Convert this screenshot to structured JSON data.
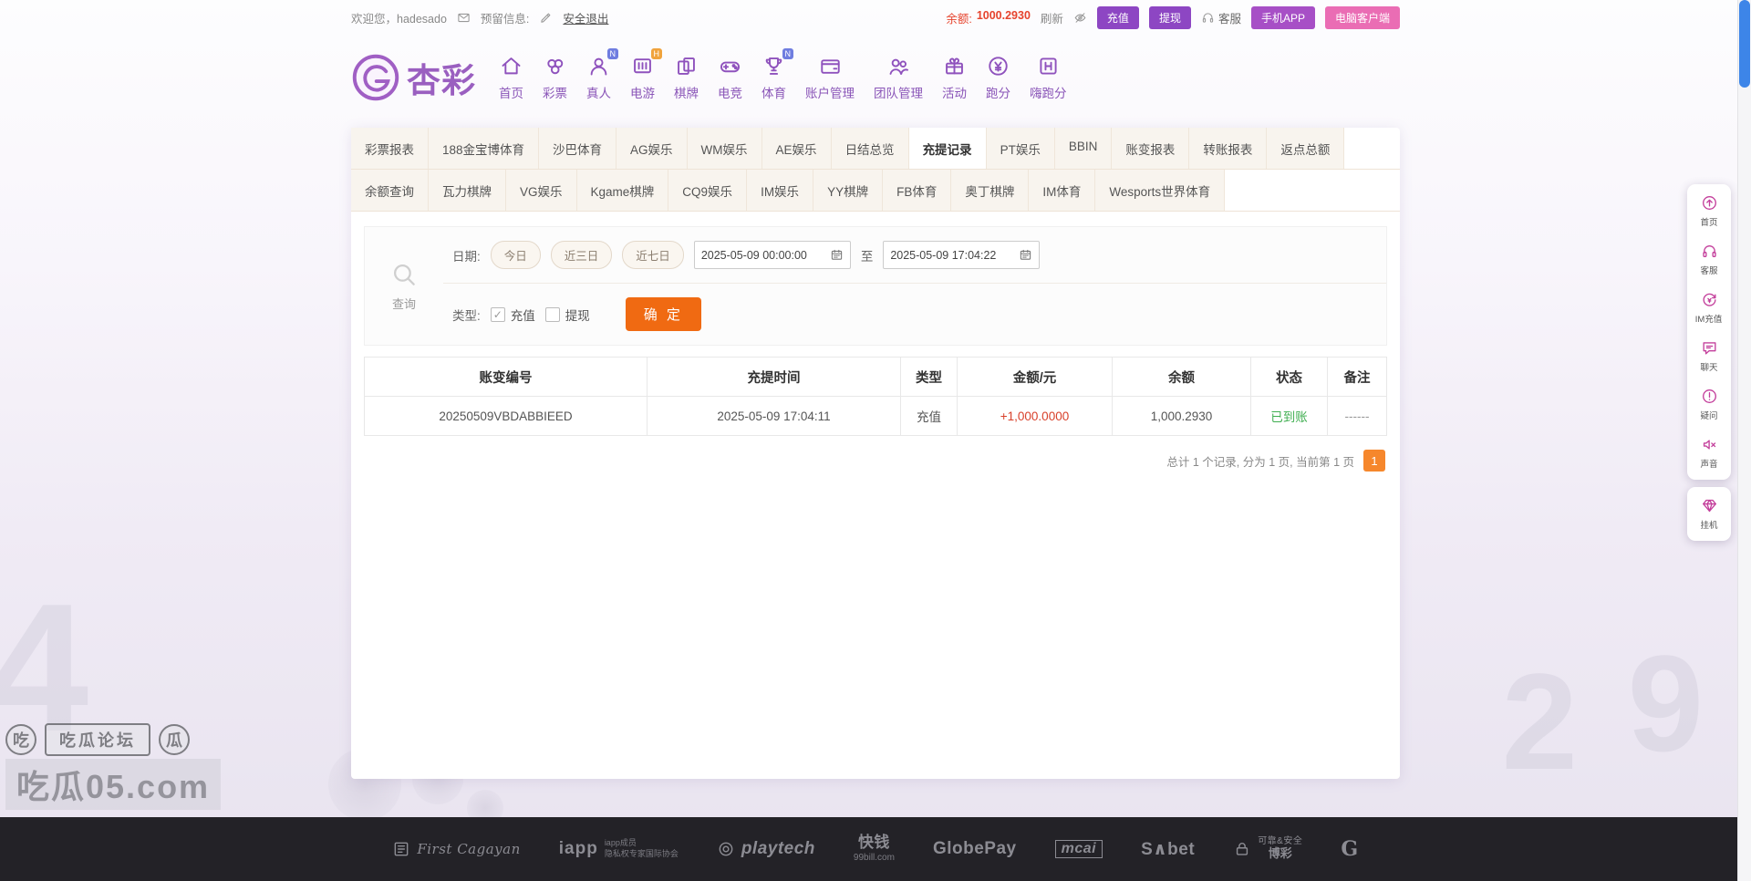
{
  "topbar": {
    "welcome": "欢迎您，hadesado",
    "reserved_label": "预留信息:",
    "logout": "安全退出",
    "balance_label": "余额:",
    "balance_value": "1000.2930",
    "refresh": "刷新",
    "deposit": "充值",
    "withdraw": "提现",
    "service": "客服",
    "mobile_app": "手机APP",
    "pc_client": "电脑客户端"
  },
  "brand": {
    "name": "杏彩"
  },
  "nav": {
    "items": [
      {
        "label": "首页",
        "icon": "home",
        "badge": ""
      },
      {
        "label": "彩票",
        "icon": "lottery",
        "badge": ""
      },
      {
        "label": "真人",
        "icon": "live",
        "badge": "N"
      },
      {
        "label": "电游",
        "icon": "egame",
        "badge": "H"
      },
      {
        "label": "棋牌",
        "icon": "chess",
        "badge": ""
      },
      {
        "label": "电竞",
        "icon": "esports",
        "badge": ""
      },
      {
        "label": "体育",
        "icon": "sports",
        "badge": "N"
      },
      {
        "label": "账户管理",
        "icon": "account",
        "badge": ""
      },
      {
        "label": "团队管理",
        "icon": "team",
        "badge": ""
      },
      {
        "label": "活动",
        "icon": "activity",
        "badge": ""
      },
      {
        "label": "跑分",
        "icon": "paofen",
        "badge": ""
      },
      {
        "label": "嗨跑分",
        "icon": "hipaofen",
        "badge": ""
      }
    ]
  },
  "tabs": {
    "active": "充提记录",
    "row1": [
      "彩票报表",
      "188金宝博体育",
      "沙巴体育",
      "AG娱乐",
      "WM娱乐",
      "AE娱乐",
      "日结总览",
      "充提记录",
      "PT娱乐",
      "BBIN",
      "账变报表",
      "转账报表",
      "返点总额"
    ],
    "row2": [
      "余额查询",
      "瓦力棋牌",
      "VG娱乐",
      "Kgame棋牌",
      "CQ9娱乐",
      "IM娱乐",
      "YY棋牌",
      "FB体育",
      "奥丁棋牌",
      "IM体育",
      "Wesports世界体育"
    ]
  },
  "filter": {
    "search_label": "查询",
    "date_label": "日期:",
    "quick_ranges": [
      "今日",
      "近三日",
      "近七日"
    ],
    "date_from": "2025-05-09 00:00:00",
    "to_label": "至",
    "date_to": "2025-05-09 17:04:22",
    "type_label": "类型:",
    "types": [
      {
        "label": "充值",
        "checked": true
      },
      {
        "label": "提现",
        "checked": false
      }
    ],
    "submit": "确 定"
  },
  "table": {
    "headers": [
      "账变编号",
      "充提时间",
      "类型",
      "金额/元",
      "余额",
      "状态",
      "备注"
    ],
    "rows": [
      {
        "cells": [
          "20250509VBDABBIEED",
          "2025-05-09 17:04:11",
          "充值",
          "+1,000.0000",
          "1,000.2930",
          "已到账",
          "------"
        ]
      }
    ]
  },
  "pagination": {
    "summary": "总计 1 个记录, 分为 1 页, 当前第 1 页",
    "current_page": "1"
  },
  "quickbar": {
    "items": [
      {
        "label": "首页",
        "icon": "top"
      },
      {
        "label": "客服",
        "icon": "headset"
      },
      {
        "label": "IM充值",
        "icon": "recharge"
      },
      {
        "label": "聊天",
        "icon": "chat"
      },
      {
        "label": "疑问",
        "icon": "question"
      },
      {
        "label": "声音",
        "icon": "sound-off"
      }
    ],
    "detached": {
      "label": "挂机",
      "icon": "gem"
    }
  },
  "footer": {
    "partners": [
      {
        "name": "first-cagayan",
        "text": "First Cagayan",
        "sub": ""
      },
      {
        "name": "iapp",
        "text": "iapp",
        "sub": "iapp成员\n隐私权专家国际协会"
      },
      {
        "name": "playtech",
        "text": "playtech",
        "sub": ""
      },
      {
        "name": "99bill",
        "text": "快钱",
        "sub": "99bill.com"
      },
      {
        "name": "globepay",
        "text": "GlobePay",
        "sub": ""
      },
      {
        "name": "mcai",
        "text": "mcai",
        "sub": ""
      },
      {
        "name": "sabet",
        "text": "S∧bet",
        "sub": ""
      },
      {
        "name": "secure",
        "text": "可靠&安全",
        "sub": "博彩"
      },
      {
        "name": "g-logo",
        "text": "G",
        "sub": ""
      }
    ]
  },
  "watermark": {
    "stamp_left": "吃",
    "stamp_center": "吃瓜论坛",
    "stamp_right": "瓜",
    "site": "吃瓜05.com"
  },
  "colors": {
    "accent_purple": "#8d46c3",
    "accent_pink": "#ea6db4",
    "accent_orange": "#f06a12",
    "balance_red": "#e6432d",
    "amount_red": "#d8402a",
    "status_green": "#3fae50",
    "page_orange": "#f6872c",
    "scrollbar_blue": "#3d85e8"
  }
}
